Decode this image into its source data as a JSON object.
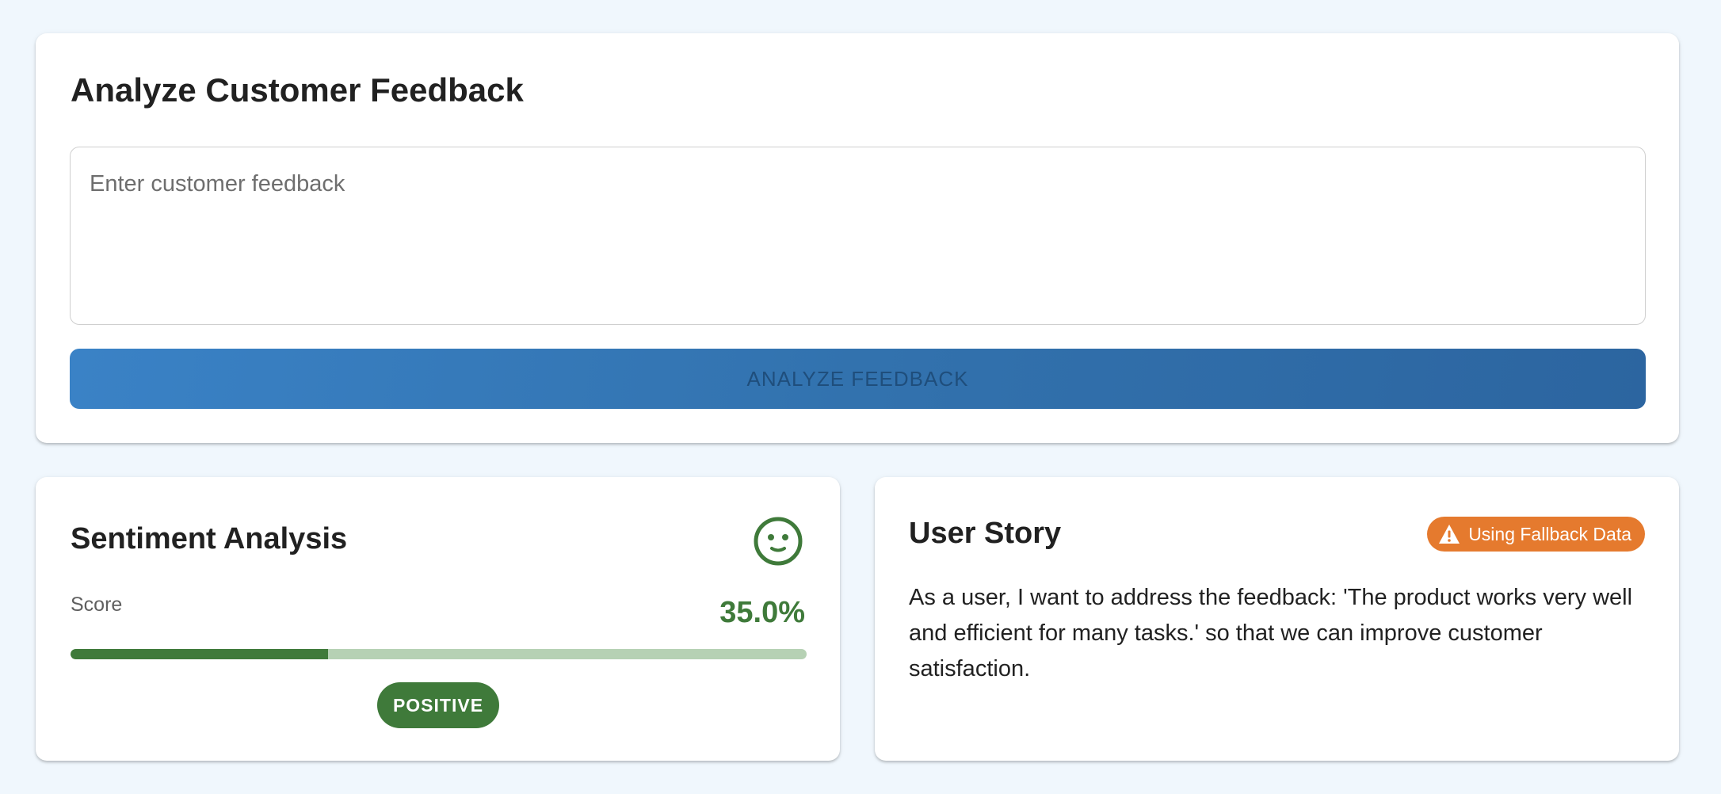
{
  "analyze": {
    "title": "Analyze Customer Feedback",
    "input_placeholder": "Enter customer feedback",
    "input_value": "",
    "button_label": "ANALYZE FEEDBACK"
  },
  "sentiment": {
    "title": "Sentiment Analysis",
    "icon": "smiley-face-icon",
    "score_label": "Score",
    "score_text": "35.0%",
    "score_fraction": 0.35,
    "label": "POSITIVE",
    "color": "#3f7a3a"
  },
  "story": {
    "title": "User Story",
    "badge_icon": "warning-icon",
    "badge_label": "Using Fallback Data",
    "badge_color": "#e57a2e",
    "text": "As a user, I want to address the feedback: 'The product works very well and efficient for many tasks.' so that we can improve customer satisfaction."
  },
  "colors": {
    "background": "#f0f7fd",
    "primary_button": "#3272ae"
  }
}
